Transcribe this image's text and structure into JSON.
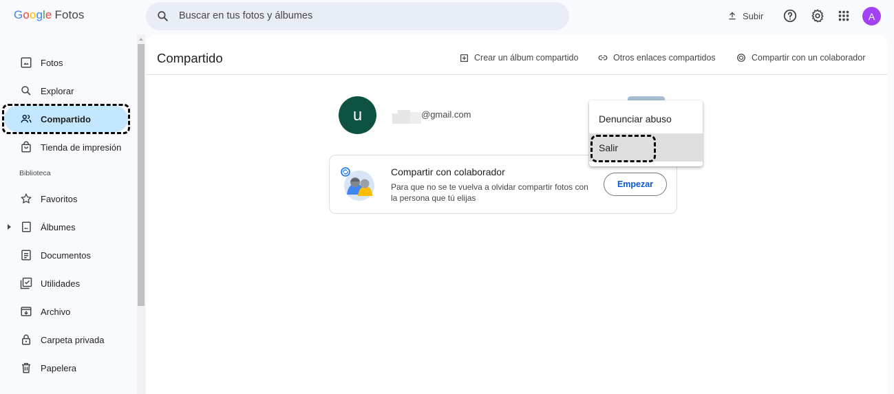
{
  "app": {
    "logo": [
      "G",
      "o",
      "o",
      "g",
      "l",
      "e"
    ],
    "logo_product": "Fotos"
  },
  "search": {
    "placeholder": "Buscar en tus fotos y álbumes"
  },
  "topbar": {
    "upload_label": "Subir",
    "avatar_letter": "A",
    "icons": [
      "help-icon",
      "settings-icon",
      "apps-grid-icon"
    ]
  },
  "sidebar": {
    "items": [
      {
        "label": "Fotos",
        "icon": "photo-icon"
      },
      {
        "label": "Explorar",
        "icon": "search-icon"
      },
      {
        "label": "Compartido",
        "icon": "people-icon",
        "active": true
      },
      {
        "label": "Tienda de impresión",
        "icon": "shopping-bag-icon"
      }
    ],
    "section_label": "Biblioteca",
    "library_items": [
      {
        "label": "Favoritos",
        "icon": "star-icon"
      },
      {
        "label": "Álbumes",
        "icon": "album-icon"
      },
      {
        "label": "Documentos",
        "icon": "document-icon"
      },
      {
        "label": "Utilidades",
        "icon": "utilities-icon"
      },
      {
        "label": "Archivo",
        "icon": "archive-icon"
      },
      {
        "label": "Carpeta privada",
        "icon": "lock-icon"
      },
      {
        "label": "Papelera",
        "icon": "trash-icon"
      }
    ]
  },
  "main": {
    "title": "Compartido",
    "actions": [
      {
        "label": "Crear un álbum compartido",
        "icon": "add-box-icon"
      },
      {
        "label": "Otros enlaces compartidos",
        "icon": "link-icon"
      },
      {
        "label": "Compartir con un colaborador",
        "icon": "partner-share-icon"
      }
    ],
    "shared_user": {
      "avatar_letter": "u",
      "email_suffix": "@gmail.com"
    },
    "partner_card": {
      "title": "Compartir con colaborador",
      "description": "Para que no se te vuelva a olvidar compartir fotos con la persona que tú elijas",
      "button_label": "Empezar"
    }
  },
  "context_menu": {
    "items": [
      "Denunciar abuso",
      "Salir"
    ],
    "hovered": "Salir"
  },
  "colors": {
    "accent": "#0b57d0",
    "active_nav": "#c2e7ff",
    "avatar": "#a142f4",
    "user_avatar": "#0d5242"
  }
}
